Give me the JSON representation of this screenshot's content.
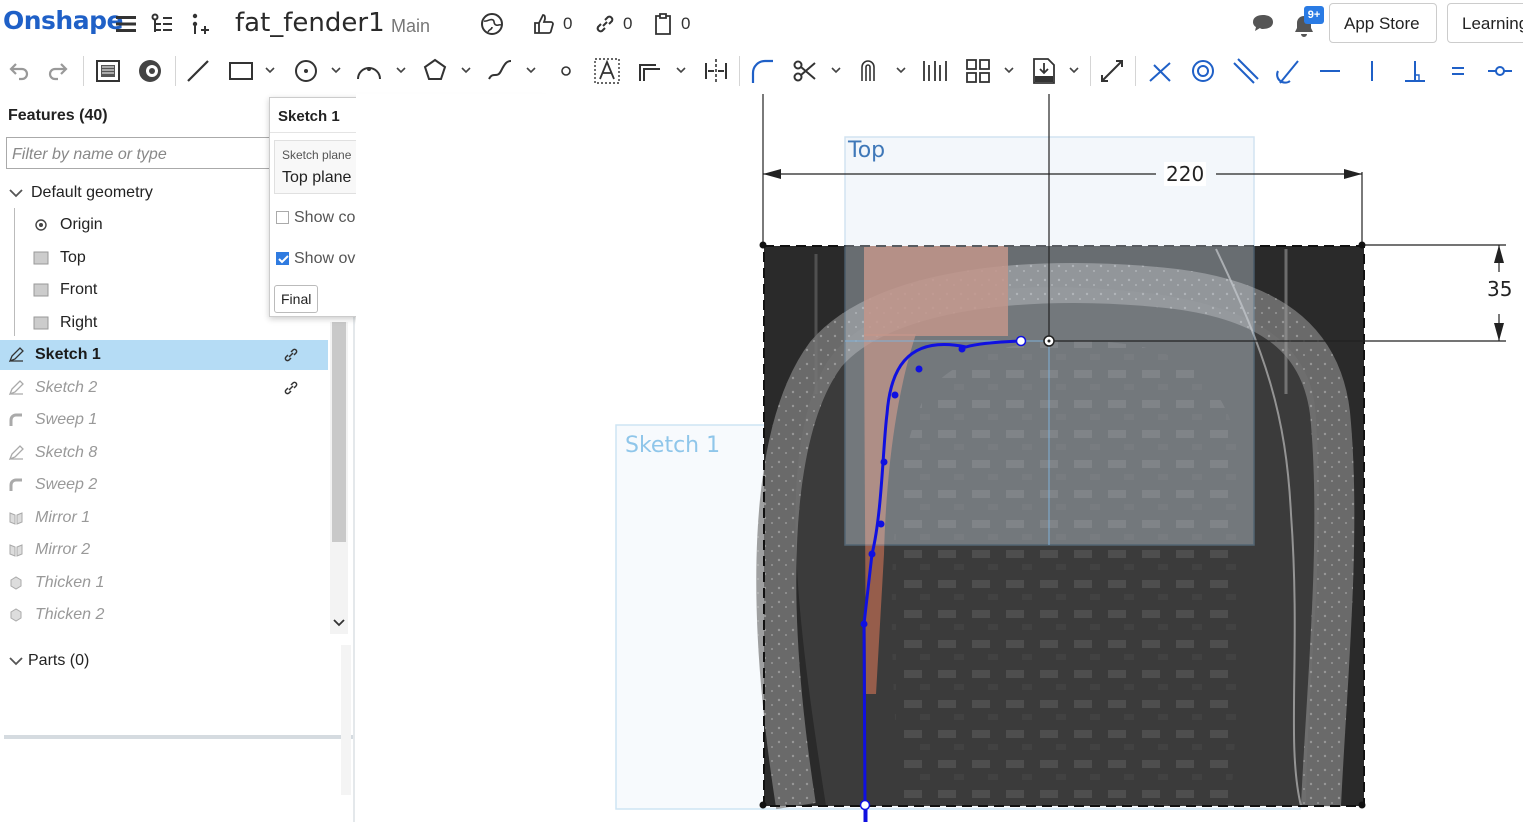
{
  "header": {
    "logo": "Onshape",
    "doc_title": "fat_fender1",
    "workspace": "Main",
    "likes": "0",
    "links": "0",
    "copies": "0",
    "notif_badge": "9+",
    "app_store": "App Store",
    "learning": "Learning"
  },
  "features": {
    "title": "Features (40)",
    "filter_placeholder": "Filter by name or type",
    "default_geometry": "Default geometry",
    "items": [
      {
        "label": "Origin"
      },
      {
        "label": "Top"
      },
      {
        "label": "Front"
      },
      {
        "label": "Right"
      },
      {
        "label": "Sketch 1"
      },
      {
        "label": "Sketch 2"
      },
      {
        "label": "Sweep 1"
      },
      {
        "label": "Sketch 8"
      },
      {
        "label": "Sweep 2"
      },
      {
        "label": "Mirror 1"
      },
      {
        "label": "Mirror 2"
      },
      {
        "label": "Thicken 1"
      },
      {
        "label": "Thicken 2"
      }
    ]
  },
  "parts": {
    "title": "Parts (0)"
  },
  "sketch_dialog": {
    "title": "Sketch 1",
    "plane_label": "Sketch plane",
    "plane_value": "Top plane",
    "clear": "×",
    "show_constraints": "Show constraints",
    "show_overdefined": "Show overdefined",
    "final": "Final",
    "help": "?"
  },
  "viewport": {
    "plane_top": "Top",
    "plane_sketch": "Sketch 1",
    "dim_width": "220",
    "dim_height": "35"
  },
  "colors": {
    "brand": "#1f60c7",
    "selection": "#b5dcf5",
    "ok_green": "#1a9a3a",
    "sketch_blue": "#1010e0",
    "plane_blue": "#7fb0d8"
  }
}
